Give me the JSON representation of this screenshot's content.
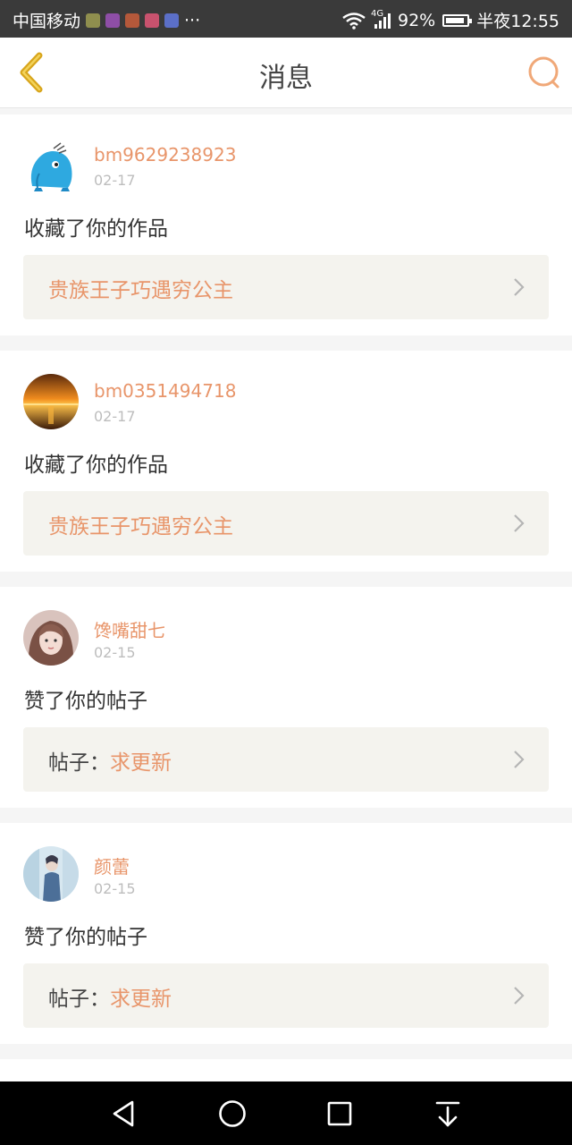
{
  "status_bar": {
    "carrier": "中国移动",
    "more": "···",
    "network": "4G",
    "battery_percent": "92%",
    "battery_level": 0.92,
    "time": "半夜12:55",
    "app_icon_colors": [
      "#8f8e4e",
      "#8e4ea6",
      "#b4583a",
      "#c8526e",
      "#5b6fc7"
    ]
  },
  "header": {
    "title": "消息"
  },
  "colors": {
    "accent": "#e8956a",
    "back_icon": "#d8a51b",
    "search_icon": "#f0a878"
  },
  "messages": [
    {
      "username": "bm9629238923",
      "date": "02-17",
      "action": "收藏了你的作品",
      "ref_prefix": "",
      "ref_title": "贵族王子巧遇穷公主",
      "avatar": "blue-creature-avatar"
    },
    {
      "username": "bm0351494718",
      "date": "02-17",
      "action": "收藏了你的作品",
      "ref_prefix": "",
      "ref_title": "贵族王子巧遇穷公主",
      "avatar": "sunset-avatar"
    },
    {
      "username": "馋嘴甜七",
      "date": "02-15",
      "action": "赞了你的帖子",
      "ref_prefix": "帖子：",
      "ref_title": "求更新",
      "avatar": "girl-photo-avatar"
    },
    {
      "username": "颜蕾",
      "date": "02-15",
      "action": "赞了你的帖子",
      "ref_prefix": "帖子：",
      "ref_title": "求更新",
      "avatar": "photo-avatar"
    }
  ],
  "nav_bar": {
    "buttons": [
      "back-nav",
      "home-nav",
      "recents-nav",
      "notification-pull-nav"
    ]
  }
}
